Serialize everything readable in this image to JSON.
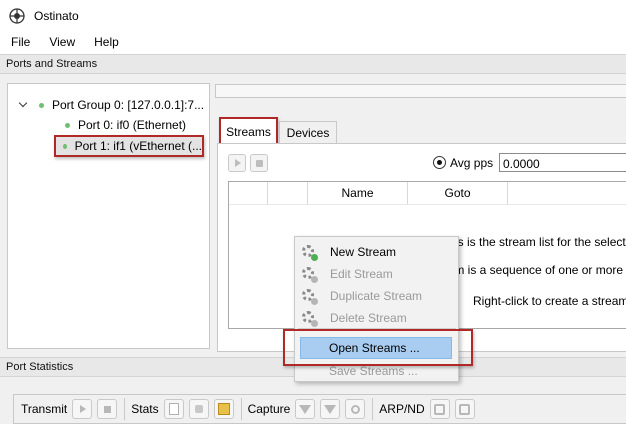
{
  "window": {
    "title": "Ostinato"
  },
  "menubar": {
    "items": [
      "File",
      "View",
      "Help"
    ]
  },
  "ports_section": {
    "title": "Ports and Streams"
  },
  "port_tree": {
    "group_label": "Port Group 0:  [127.0.0.1]:7...",
    "ports": [
      {
        "label": "Port 0: if0 (Ethernet)"
      },
      {
        "label": "Port 1: if1 (vEthernet (..."
      }
    ]
  },
  "tabs": {
    "streams": "Streams",
    "devices": "Devices"
  },
  "stream_toolbar": {
    "avg_pps_label": "Avg pps",
    "avg_pps_value": "0.0000"
  },
  "stream_table": {
    "columns": [
      "",
      "",
      "Name",
      "Goto",
      ""
    ],
    "info_lines": [
      "This is the stream list for the selecte",
      "eam is a sequence of one or more",
      "Right-click to create a stream"
    ]
  },
  "context_menu": {
    "items": [
      {
        "label": "New Stream",
        "icon": "gear-add-icon",
        "enabled": true
      },
      {
        "label": "Edit Stream",
        "icon": "gear-edit-icon",
        "enabled": false
      },
      {
        "label": "Duplicate Stream",
        "icon": "gear-duplicate-icon",
        "enabled": false
      },
      {
        "label": "Delete Stream",
        "icon": "gear-delete-icon",
        "enabled": false
      },
      {
        "label": "Open Streams ...",
        "enabled": true,
        "highlighted": true
      },
      {
        "label": "Save Streams ...",
        "enabled": false
      }
    ]
  },
  "stats_section": {
    "title": "Port Statistics"
  },
  "stats_toolbar": {
    "transmit_label": "Transmit",
    "stats_label": "Stats",
    "capture_label": "Capture",
    "arp_nd_label": "ARP/ND"
  },
  "colors": {
    "annotation_red": "#b02929",
    "menu_highlight": "#a8cdf1",
    "link_up_green": "#6fbf73"
  }
}
